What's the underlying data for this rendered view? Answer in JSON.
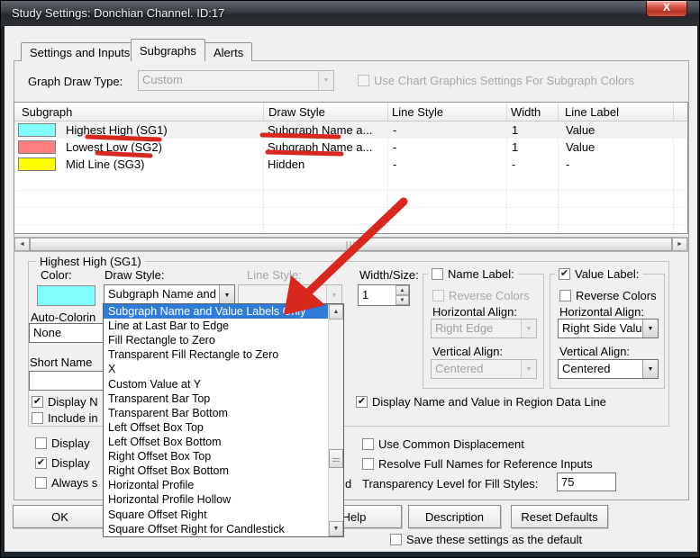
{
  "glyphs": {
    "check": "✔",
    "down": "▼",
    "up": "▲",
    "left": "◄",
    "right": "►",
    "close": "X"
  },
  "colors": {
    "annotation_red": "#d8271d",
    "selection_blue": "#2e7cd9",
    "dialog_bg": "#f0f0f0",
    "close_button_red": "#c0392b"
  },
  "window": {
    "title": "Study Settings: Donchian Channel. ID:17"
  },
  "tabs": [
    "Settings and Inputs",
    "Subgraphs",
    "Alerts"
  ],
  "toolbar": {
    "graph_draw_type_label": "Graph Draw Type:",
    "graph_draw_type_value": "Custom",
    "use_chart_graphics_label": "Use Chart Graphics Settings For Subgraph Colors"
  },
  "table": {
    "columns": [
      "Subgraph",
      "Draw Style",
      "Line Style",
      "Width",
      "Line Label"
    ],
    "rows": [
      {
        "color": "#7fffff",
        "name": "Highest High (SG1)",
        "draw_style": "Subgraph Name a...",
        "line_style": "-",
        "width": "1",
        "line_label": "Value"
      },
      {
        "color": "#ff7f7f",
        "name": "Lowest Low (SG2)",
        "draw_style": "Subgraph Name a...",
        "line_style": "-",
        "width": "1",
        "line_label": "Value"
      },
      {
        "color": "#ffff00",
        "name": "Mid Line (SG3)",
        "draw_style": "Hidden",
        "line_style": "-",
        "width": "-",
        "line_label": "-"
      }
    ]
  },
  "group": {
    "legend": "Highest High (SG1)",
    "color_label": "Color:",
    "color_value": "#7fffff",
    "draw_style_label": "Draw Style:",
    "draw_style_value": "Subgraph Name and",
    "line_style_label": "Line Style:",
    "width_size_label": "Width/Size:",
    "width_size_value": "1",
    "auto_color_label": "Auto-Colorin",
    "auto_color_value": "None",
    "short_name_label": "Short Name",
    "display_n_label": "Display N",
    "include_in_label": "Include in",
    "display_region_label": "Display Name and Value in Region Data Line",
    "name_label": {
      "legend": "Name Label:",
      "reverse_label": "Reverse Colors",
      "h_align_label": "Horizontal Align:",
      "h_align_value": "Right Edge",
      "v_align_label": "Vertical Align:",
      "v_align_value": "Centered"
    },
    "value_label": {
      "legend": "Value Label:",
      "reverse_label": "Reverse Colors",
      "h_align_label": "Horizontal Align:",
      "h_align_value": "Right Side Valu",
      "v_align_label": "Vertical Align:",
      "v_align_value": "Centered"
    }
  },
  "dropdown": {
    "selected_index": 0,
    "items": [
      "Subgraph Name and Value Labels Only",
      "Line at Last Bar to Edge",
      "Fill Rectangle to Zero",
      "Transparent Fill Rectangle to Zero",
      "X",
      "Custom Value at Y",
      "Transparent Bar Top",
      "Transparent Bar Bottom",
      "Left Offset Box Top",
      "Left Offset Box Bottom",
      "Right Offset Box Top",
      "Right Offset Box Bottom",
      "Horizontal Profile",
      "Horizontal Profile Hollow",
      "Square Offset Right",
      "Square Offset Right for Candlestick"
    ]
  },
  "bottom": {
    "display_1_label": "Display",
    "display_2_label": "Display",
    "always_label": "Always s",
    "use_common_label": "Use Common Displacement",
    "resolve_label": "Resolve Full Names for Reference Inputs",
    "transparency_label": "Transparency Level for Fill Styles:",
    "transparency_value": "75",
    "hidden_fragment": "d",
    "save_default_label": "Save these settings as the default"
  },
  "buttons": {
    "ok": "OK",
    "help": "Help",
    "description": "Description",
    "reset_defaults": "Reset Defaults"
  }
}
